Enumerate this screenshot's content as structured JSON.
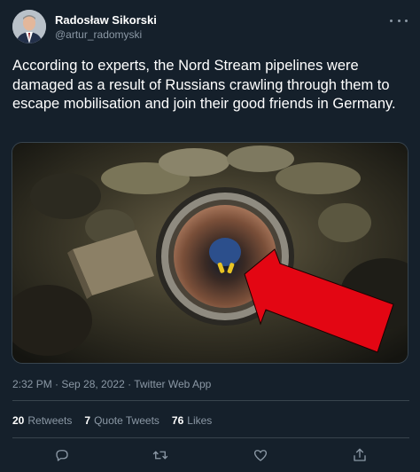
{
  "author": {
    "display_name": "Radosław Sikorski",
    "handle": "@artur_radomyski"
  },
  "tweet": {
    "text": "According to experts, the Nord Stream pipelines were damaged as a result of Russians crawling through them to escape mobilisation and join their good friends in Germany.",
    "meta": "2:32 PM · Sep 28, 2022 · Twitter Web App"
  },
  "stats": {
    "retweets_count": "20",
    "retweets_label": "Retweets",
    "quotes_count": "7",
    "quotes_label": "Quote Tweets",
    "likes_count": "76",
    "likes_label": "Likes"
  },
  "icons": {
    "more": "more-icon",
    "reply": "reply-icon",
    "retweet": "retweet-icon",
    "like": "heart-icon",
    "share": "share-icon"
  },
  "colors": {
    "background": "#15202b",
    "secondary_text": "#8b98a5",
    "divider": "#38444d",
    "arrow": "#e30613"
  }
}
